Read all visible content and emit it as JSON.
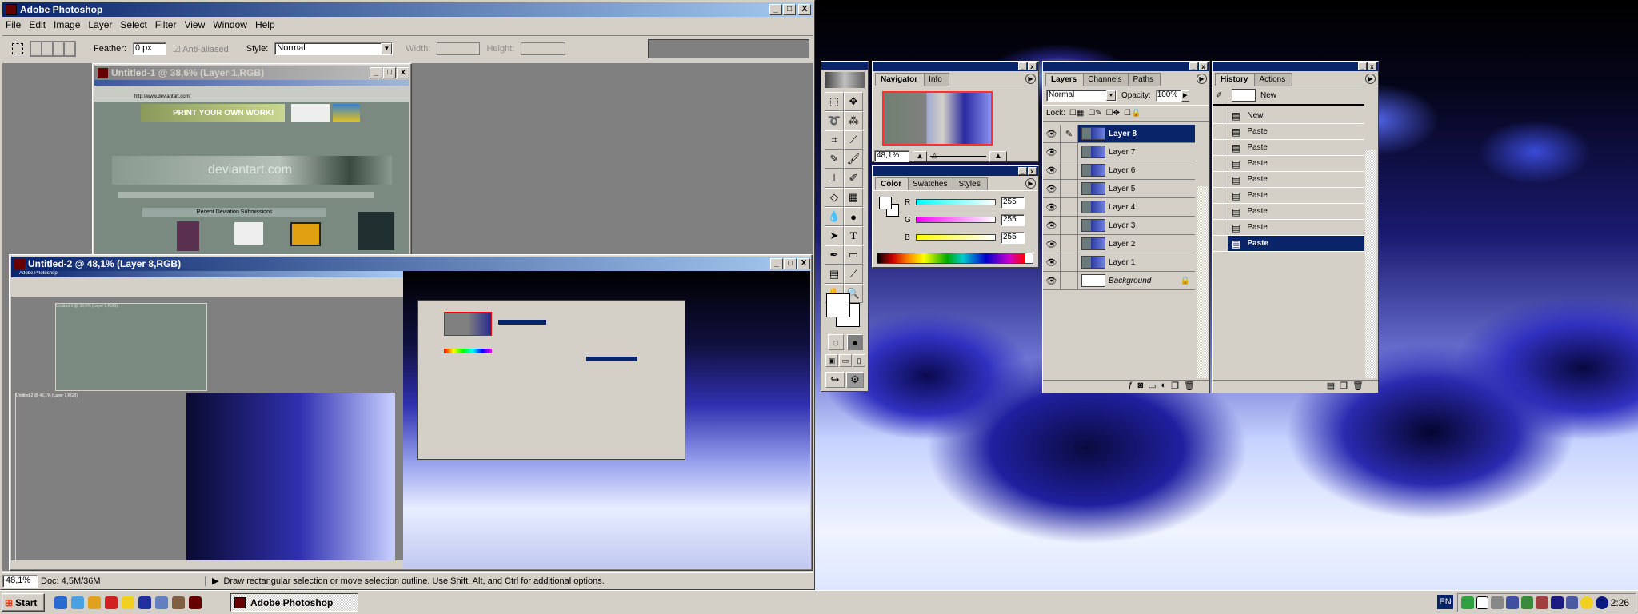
{
  "app": {
    "title": "Adobe Photoshop",
    "window_buttons": [
      "_",
      "□",
      "X"
    ]
  },
  "menu": [
    "File",
    "Edit",
    "Image",
    "Layer",
    "Select",
    "Filter",
    "View",
    "Window",
    "Help"
  ],
  "options": {
    "feather_label": "Feather:",
    "feather_value": "0 px",
    "antialiased_label": "Anti-aliased",
    "antialiased_checked": true,
    "style_label": "Style:",
    "style_value": "Normal",
    "width_label": "Width:",
    "height_label": "Height:"
  },
  "doc1": {
    "title": "Untitled-1 @ 38,6% (Layer 1,RGB)",
    "banner": "PRINT YOUR OWN WORK!",
    "site": "deviantart.com",
    "section": "Recent Deviation Submissions",
    "url": "http://www.deviantart.com/"
  },
  "doc2": {
    "title": "Untitled-2 @ 48,1% (Layer 8,RGB)",
    "nested_title": "Adobe Photoshop",
    "nested_doc1": "Untitled-1 @ 38,6% (Layer 1,RGB)",
    "nested_doc2": "Untitled-2 @ 48,1% (Layer 7,RGB)"
  },
  "status": {
    "zoom": "48,1%",
    "doc": "Doc: 4,5M/36M",
    "hint": "Draw rectangular selection or move selection outline. Use Shift, Alt, and Ctrl for additional options."
  },
  "navigator": {
    "tabs": [
      "Navigator",
      "Info"
    ],
    "zoom": "48,1%",
    "proxy_color": "#ff3030"
  },
  "color": {
    "tabs": [
      "Color",
      "Swatches",
      "Styles"
    ],
    "channels": [
      {
        "label": "R",
        "value": "255",
        "color": "#00ffff"
      },
      {
        "label": "G",
        "value": "255",
        "color": "#ff00ff"
      },
      {
        "label": "B",
        "value": "255",
        "color": "#ffff00"
      }
    ]
  },
  "layers": {
    "tabs": [
      "Layers",
      "Channels",
      "Paths"
    ],
    "blend": "Normal",
    "opacity_label": "Opacity:",
    "opacity": "100%",
    "lock_label": "Lock:",
    "items": [
      {
        "name": "Layer 8",
        "selected": true
      },
      {
        "name": "Layer 7"
      },
      {
        "name": "Layer 6"
      },
      {
        "name": "Layer 5"
      },
      {
        "name": "Layer 4"
      },
      {
        "name": "Layer 3"
      },
      {
        "name": "Layer 2"
      },
      {
        "name": "Layer 1"
      },
      {
        "name": "Background",
        "locked": true
      }
    ]
  },
  "history": {
    "tabs": [
      "History",
      "Actions"
    ],
    "snapshot": "New",
    "items": [
      "New",
      "Paste",
      "Paste",
      "Paste",
      "Paste",
      "Paste",
      "Paste",
      "Paste",
      "Paste"
    ],
    "selected_index": 8
  },
  "taskbar": {
    "start": "Start",
    "task": "Adobe Photoshop",
    "lang": "EN",
    "clock": "2:26"
  },
  "colors": {
    "title_active": "#0a246a",
    "selection": "#0a246a",
    "face": "#d4d0c8"
  }
}
